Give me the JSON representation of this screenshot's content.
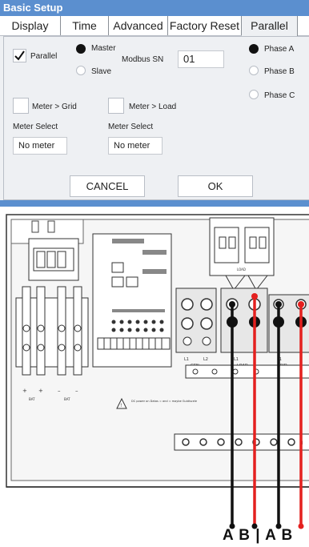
{
  "window": {
    "title": "Basic Setup"
  },
  "tabs": [
    {
      "label": "Display",
      "active": false
    },
    {
      "label": "Time",
      "active": false
    },
    {
      "label": "Advanced",
      "active": false
    },
    {
      "label": "Factory Reset",
      "active": false
    },
    {
      "label": "Parallel",
      "active": true
    }
  ],
  "parallel": {
    "checkbox_label": "Parallel",
    "checked": true,
    "role_options": [
      {
        "label": "Master",
        "selected": true
      },
      {
        "label": "Slave",
        "selected": false
      }
    ],
    "modbus_label": "Modbus SN",
    "modbus_value": "01",
    "phase_options": [
      {
        "label": "Phase A",
        "selected": true
      },
      {
        "label": "Phase B",
        "selected": false
      },
      {
        "label": "Phase C",
        "selected": false
      }
    ]
  },
  "meters": {
    "grid_label": "Meter > Grid",
    "grid_checked": false,
    "load_label": "Meter > Load",
    "load_checked": false,
    "select_label_1": "Meter Select",
    "select_value_1": "No meter",
    "select_label_2": "Meter Select",
    "select_value_2": "No meter"
  },
  "buttons": {
    "cancel": "CANCEL",
    "ok": "OK"
  },
  "diagram": {
    "labels": {
      "bat": "BAT",
      "gen": "GEN",
      "load": "LOAD",
      "grid": "GRID",
      "n": "N",
      "l1": "L1",
      "l2": "L2",
      "warning": "DC power on Datas = and = maybe Guidiscele"
    },
    "caption": "A B | A B",
    "wire_colors": {
      "black": "#111111",
      "red": "#e4201f"
    }
  }
}
